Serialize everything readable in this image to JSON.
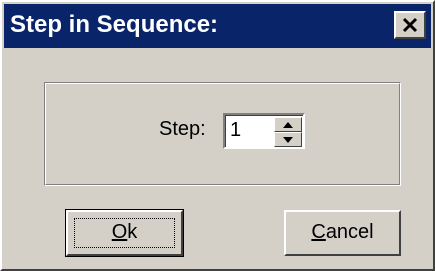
{
  "window": {
    "title": "Step in Sequence:"
  },
  "step": {
    "label": "Step:",
    "value": "1"
  },
  "buttons": {
    "ok": {
      "mnemonic": "O",
      "rest": "k"
    },
    "cancel": {
      "mnemonic": "C",
      "rest": "ancel"
    }
  },
  "icons": {
    "close": "close-icon",
    "spin_up": "up-arrow-icon",
    "spin_down": "down-arrow-icon"
  },
  "colors": {
    "titlebar": "#0a246a",
    "face": "#d4d0c8"
  }
}
